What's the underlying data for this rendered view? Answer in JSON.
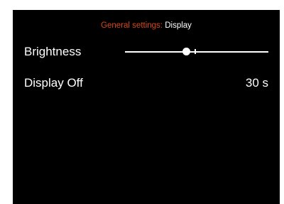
{
  "header": {
    "path": "General settings:",
    "current": "Display"
  },
  "settings": {
    "brightness": {
      "label": "Brightness",
      "level": 0.43,
      "default_level": 0.49
    },
    "display_off": {
      "label": "Display Off",
      "value": "30 s"
    }
  },
  "colors": {
    "background": "#000000",
    "accent": "#d9481c",
    "text": "#ffffff"
  }
}
